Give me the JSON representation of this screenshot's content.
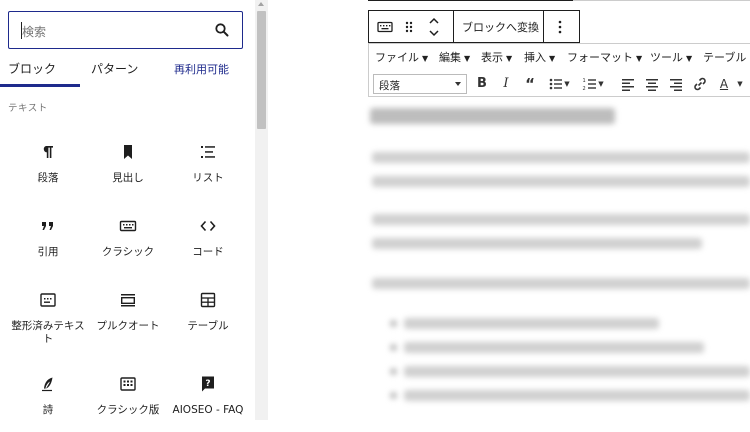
{
  "inserter": {
    "search": {
      "placeholder": "検索"
    },
    "tabs": [
      "ブロック",
      "パターン",
      "再利用可能"
    ],
    "section_title": "テキスト",
    "blocks": [
      {
        "label": "段落",
        "icon": "paragraph-icon"
      },
      {
        "label": "見出し",
        "icon": "bookmark-icon"
      },
      {
        "label": "リスト",
        "icon": "list-icon"
      },
      {
        "label": "引用",
        "icon": "quote-icon"
      },
      {
        "label": "クラシック",
        "icon": "keyboard-icon"
      },
      {
        "label": "コード",
        "icon": "code-icon"
      },
      {
        "label": "整形済みテキスト",
        "icon": "preformatted-icon"
      },
      {
        "label": "プルクオート",
        "icon": "pullquote-icon"
      },
      {
        "label": "テーブル",
        "icon": "table-icon"
      },
      {
        "label": "詩",
        "icon": "feather-icon"
      },
      {
        "label": "クラシック版",
        "icon": "classic-grid-icon"
      },
      {
        "label": "AIOSEO - FAQ",
        "icon": "faq-icon"
      }
    ]
  },
  "block_toolbar": {
    "convert_label": "ブロックへ変換"
  },
  "tinymce": {
    "menus": [
      "ファイル",
      "編集",
      "表示",
      "挿入",
      "フォーマット",
      "ツール",
      "テーブル"
    ],
    "format_select": "段落"
  },
  "colors": {
    "accent": "#1e2a8c",
    "text": "#1e1e1e",
    "muted": "#757575"
  }
}
